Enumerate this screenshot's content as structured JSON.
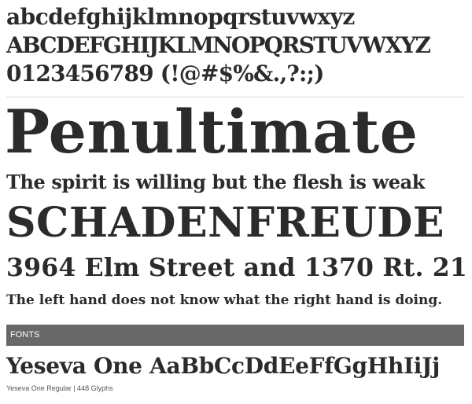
{
  "specimen": {
    "lowercase": "abcdefghijklmnopqrstuvwxyz",
    "uppercase": "ABCDEFGHIJKLMNOPQRSTUVWXYZ",
    "digits_punctuation": "0123456789 (!@#$%&.,?:;)",
    "display_word": "Penultimate",
    "proverb": "The spirit is willing but the flesh is weak",
    "german_word": "SCHADENFREUDE",
    "address": "3964 Elm Street and 1370 Rt. 21",
    "sentence": "The left hand does not know what the right hand is doing."
  },
  "fonts_section": {
    "header": "FONTS",
    "sample": "Yeseva One AaBbCcDdEeFfGgHhIiJj",
    "meta": "Yeseva One Regular | 448 Glyphs"
  },
  "colors": {
    "text": "#2b2b2b",
    "bar": "#686868",
    "bar_text": "#ffffff",
    "divider": "#d6d6d6"
  }
}
